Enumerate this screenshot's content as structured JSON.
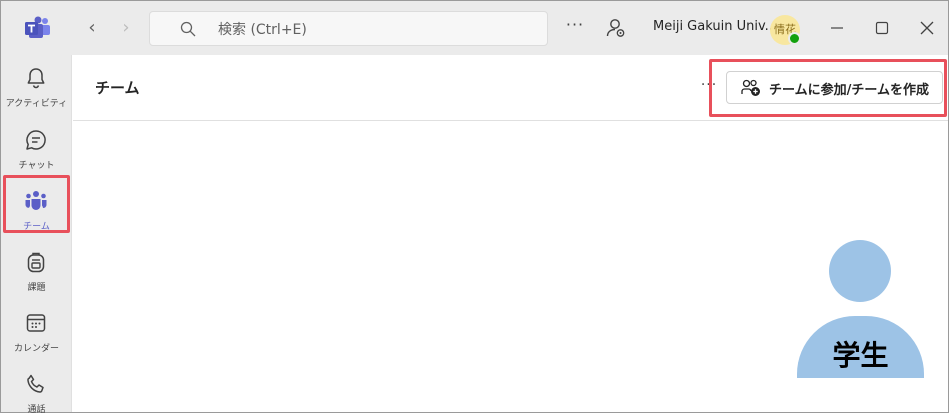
{
  "titlebar": {
    "search_placeholder": "検索 (Ctrl+E)",
    "more_label": "···",
    "org_name": "Meiji Gakuin Univ...",
    "avatar_initials": "情花",
    "nav_back": "‹",
    "nav_forward": "›"
  },
  "rail": {
    "items": [
      {
        "label": "アクティビティ",
        "icon": "bell-icon"
      },
      {
        "label": "チャット",
        "icon": "chat-icon"
      },
      {
        "label": "チーム",
        "icon": "teams-icon"
      },
      {
        "label": "課題",
        "icon": "backpack-icon"
      },
      {
        "label": "カレンダー",
        "icon": "calendar-icon"
      },
      {
        "label": "通話",
        "icon": "phone-icon"
      }
    ],
    "active_index": 2
  },
  "content": {
    "title": "チーム",
    "more_label": "···",
    "join_button_label": "チームに参加/チームを作成"
  },
  "student": {
    "label": "学生"
  },
  "colors": {
    "accent": "#5b5fc7",
    "highlight": "#e8505b",
    "student_fill": "#9dc3e6",
    "status_available": "#13a10e"
  }
}
